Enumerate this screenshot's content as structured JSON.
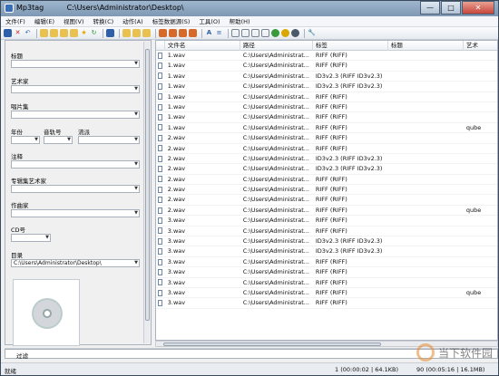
{
  "window": {
    "title": "Mp3tag          C:\\Users\\Administrator\\Desktop\\"
  },
  "menu": [
    "文件(F)",
    "编辑(E)",
    "视图(V)",
    "转换(C)",
    "动作(A)",
    "标签数据源(S)",
    "工具(O)",
    "帮助(H)"
  ],
  "left_panel": {
    "fields": [
      {
        "label": "标题",
        "value": ""
      },
      {
        "label": "艺术家",
        "value": ""
      },
      {
        "label": "唱片集",
        "value": ""
      },
      {
        "label": "年份",
        "value": ""
      },
      {
        "label": "音轨号",
        "value": ""
      },
      {
        "label": "流派",
        "value": ""
      },
      {
        "label": "注释",
        "value": ""
      },
      {
        "label": "专辑集艺术家",
        "value": ""
      },
      {
        "label": "作曲家",
        "value": ""
      },
      {
        "label": "CD号",
        "value": ""
      },
      {
        "label": "目录",
        "value": "C:\\Users\\Administrator\\Desktop\\"
      }
    ]
  },
  "grid": {
    "columns": [
      "文件名",
      "路径",
      "标签",
      "标题",
      "艺术"
    ],
    "rows": [
      {
        "file": "1.wav",
        "path": "C:\\Users\\Administrat...",
        "tag": "RIFF (RIFF)",
        "title": "",
        "artist": ""
      },
      {
        "file": "1.wav",
        "path": "C:\\Users\\Administrat...",
        "tag": "RIFF (RIFF)",
        "title": "",
        "artist": ""
      },
      {
        "file": "1.wav",
        "path": "C:\\Users\\Administrat...",
        "tag": "ID3v2.3 (RIFF ID3v2.3)",
        "title": "",
        "artist": ""
      },
      {
        "file": "1.wav",
        "path": "C:\\Users\\Administrat...",
        "tag": "ID3v2.3 (RIFF ID3v2.3)",
        "title": "",
        "artist": ""
      },
      {
        "file": "1.wav",
        "path": "C:\\Users\\Administrat...",
        "tag": "RIFF (RIFF)",
        "title": "",
        "artist": ""
      },
      {
        "file": "1.wav",
        "path": "C:\\Users\\Administrat...",
        "tag": "RIFF (RIFF)",
        "title": "",
        "artist": ""
      },
      {
        "file": "1.wav",
        "path": "C:\\Users\\Administrat...",
        "tag": "RIFF (RIFF)",
        "title": "",
        "artist": ""
      },
      {
        "file": "1.wav",
        "path": "C:\\Users\\Administrat...",
        "tag": "RIFF (RIFF)",
        "title": "",
        "artist": "qube"
      },
      {
        "file": "2.wav",
        "path": "C:\\Users\\Administrat...",
        "tag": "RIFF (RIFF)",
        "title": "",
        "artist": ""
      },
      {
        "file": "2.wav",
        "path": "C:\\Users\\Administrat...",
        "tag": "RIFF (RIFF)",
        "title": "",
        "artist": ""
      },
      {
        "file": "2.wav",
        "path": "C:\\Users\\Administrat...",
        "tag": "ID3v2.3 (RIFF ID3v2.3)",
        "title": "",
        "artist": ""
      },
      {
        "file": "2.wav",
        "path": "C:\\Users\\Administrat...",
        "tag": "ID3v2.3 (RIFF ID3v2.3)",
        "title": "",
        "artist": ""
      },
      {
        "file": "2.wav",
        "path": "C:\\Users\\Administrat...",
        "tag": "RIFF (RIFF)",
        "title": "",
        "artist": ""
      },
      {
        "file": "2.wav",
        "path": "C:\\Users\\Administrat...",
        "tag": "RIFF (RIFF)",
        "title": "",
        "artist": ""
      },
      {
        "file": "2.wav",
        "path": "C:\\Users\\Administrat...",
        "tag": "RIFF (RIFF)",
        "title": "",
        "artist": ""
      },
      {
        "file": "2.wav",
        "path": "C:\\Users\\Administrat...",
        "tag": "RIFF (RIFF)",
        "title": "",
        "artist": "qube"
      },
      {
        "file": "3.wav",
        "path": "C:\\Users\\Administrat...",
        "tag": "RIFF (RIFF)",
        "title": "",
        "artist": ""
      },
      {
        "file": "3.wav",
        "path": "C:\\Users\\Administrat...",
        "tag": "RIFF (RIFF)",
        "title": "",
        "artist": ""
      },
      {
        "file": "3.wav",
        "path": "C:\\Users\\Administrat...",
        "tag": "ID3v2.3 (RIFF ID3v2.3)",
        "title": "",
        "artist": ""
      },
      {
        "file": "3.wav",
        "path": "C:\\Users\\Administrat...",
        "tag": "ID3v2.3 (RIFF ID3v2.3)",
        "title": "",
        "artist": ""
      },
      {
        "file": "3.wav",
        "path": "C:\\Users\\Administrat...",
        "tag": "RIFF (RIFF)",
        "title": "",
        "artist": ""
      },
      {
        "file": "3.wav",
        "path": "C:\\Users\\Administrat...",
        "tag": "RIFF (RIFF)",
        "title": "",
        "artist": ""
      },
      {
        "file": "3.wav",
        "path": "C:\\Users\\Administrat...",
        "tag": "RIFF (RIFF)",
        "title": "",
        "artist": ""
      },
      {
        "file": "3.wav",
        "path": "C:\\Users\\Administrat...",
        "tag": "RIFF (RIFF)",
        "title": "",
        "artist": "qube"
      },
      {
        "file": "3.wav",
        "path": "C:\\Users\\Administrat...",
        "tag": "RIFF (RIFF)",
        "title": "",
        "artist": ""
      }
    ]
  },
  "filter": {
    "label": "过滤",
    "value": ""
  },
  "status": {
    "left": "就绪",
    "selection": "1 (00:00:02 | 64.1KB)",
    "total": "90 (00:05:16 | 16.1MB)"
  },
  "watermark": "当下软件园",
  "colors": {
    "accent": "#3a6db8",
    "selected": "#cce4f7"
  }
}
